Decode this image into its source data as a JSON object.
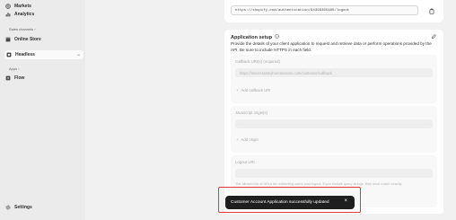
{
  "sidebar": {
    "items_top": [
      {
        "label": "Markets",
        "icon": "globe-icon"
      },
      {
        "label": "Analytics",
        "icon": "bar-chart-icon"
      }
    ],
    "sales_channels_heading": "Sales channels",
    "online_store": {
      "label": "Online Store",
      "icon": "store-icon"
    },
    "headless": {
      "label": "Headless",
      "icon": "headless-icon",
      "more": "•••"
    },
    "apps_heading": "Apps",
    "flow": {
      "label": "Flow",
      "icon": "flow-icon"
    },
    "settings": {
      "label": "Settings",
      "icon": "gear-icon"
    }
  },
  "logout_url_top": "https://shopify.com/authentication/94398365485/logout",
  "application_setup": {
    "title": "Application setup",
    "description": "Provide the details of your client application to request and retrieve data or perform operations provided by the API. Be sure to include HTTPS in each field.",
    "callback": {
      "label": "Callback URI(s) (required)",
      "value": "https://server.tasteyhoremotions.com/customer/callback",
      "add_label": "Add callback URI"
    },
    "javascript": {
      "label": "Javascript origin(s)",
      "value": "",
      "add_label": "Add origin"
    },
    "logout": {
      "label": "Logout URI",
      "value": "",
      "hint": "The allowed list of URLs for redirecting users post-logout. If you include query strings, they must match exactly."
    }
  },
  "toast": {
    "message": "Customer Account Application successfully updated",
    "close": "×"
  },
  "colors": {
    "sidebar_bg": "#ebebeb",
    "toast_bg": "#1f1f1f",
    "highlight": "#e03b3b"
  }
}
